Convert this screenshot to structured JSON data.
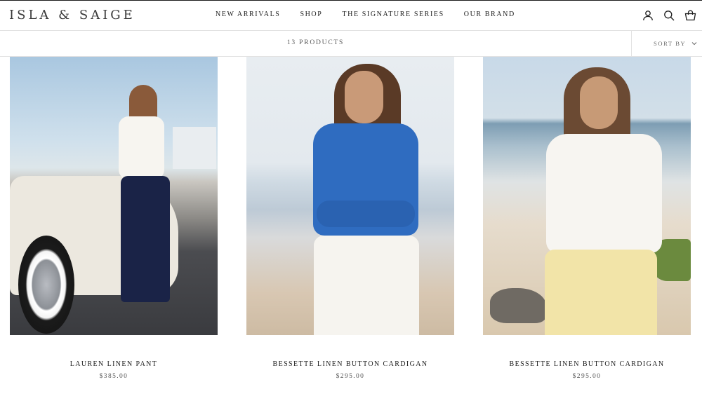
{
  "brand": {
    "name": "ISLA & SAIGE"
  },
  "nav": {
    "items": [
      {
        "label": "NEW ARRIVALS"
      },
      {
        "label": "SHOP"
      },
      {
        "label": "THE SIGNATURE SERIES"
      },
      {
        "label": "OUR BRAND"
      }
    ]
  },
  "header_icons": [
    "account-icon",
    "search-icon",
    "cart-icon"
  ],
  "toolbar": {
    "count_label": "13 PRODUCTS",
    "sort_label": "SORT BY"
  },
  "products": [
    {
      "name": "LAUREN LINEN PANT",
      "price": "$385.00"
    },
    {
      "name": "BESSETTE LINEN BUTTON CARDIGAN",
      "price": "$295.00"
    },
    {
      "name": "BESSETTE LINEN BUTTON CARDIGAN",
      "price": "$295.00"
    }
  ],
  "colors": {
    "text": "#1c1c1c",
    "muted": "#555555",
    "border": "#e2e2e2"
  }
}
